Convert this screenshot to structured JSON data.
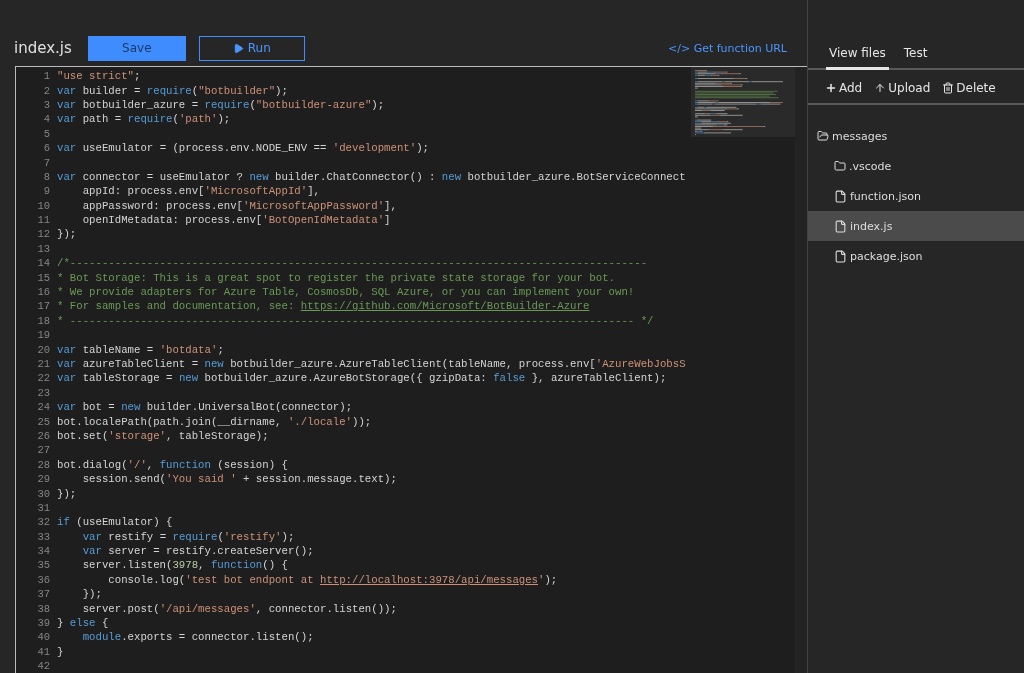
{
  "editor": {
    "filename": "index.js",
    "save_button": "Save",
    "run_button": "Run",
    "function_url_link": "</> Get function URL",
    "lines": [
      {
        "number": "1",
        "tokens": [
          {
            "kind": "string",
            "text": "\"use strict\""
          },
          {
            "kind": "plain",
            "text": ";"
          }
        ]
      },
      {
        "number": "2",
        "tokens": [
          {
            "kind": "keyword",
            "text": "var"
          },
          {
            "kind": "plain",
            "text": " builder = "
          },
          {
            "kind": "keyword",
            "text": "require"
          },
          {
            "kind": "plain",
            "text": "("
          },
          {
            "kind": "string",
            "text": "\"botbuilder\""
          },
          {
            "kind": "plain",
            "text": ");"
          }
        ]
      },
      {
        "number": "3",
        "tokens": [
          {
            "kind": "keyword",
            "text": "var"
          },
          {
            "kind": "plain",
            "text": " botbuilder_azure = "
          },
          {
            "kind": "keyword",
            "text": "require"
          },
          {
            "kind": "plain",
            "text": "("
          },
          {
            "kind": "string",
            "text": "\"botbuilder-azure\""
          },
          {
            "kind": "plain",
            "text": ");"
          }
        ]
      },
      {
        "number": "4",
        "tokens": [
          {
            "kind": "keyword",
            "text": "var"
          },
          {
            "kind": "plain",
            "text": " path = "
          },
          {
            "kind": "keyword",
            "text": "require"
          },
          {
            "kind": "plain",
            "text": "("
          },
          {
            "kind": "string",
            "text": "'path'"
          },
          {
            "kind": "plain",
            "text": ");"
          }
        ]
      },
      {
        "number": "5"
      },
      {
        "number": "6",
        "tokens": [
          {
            "kind": "keyword",
            "text": "var"
          },
          {
            "kind": "plain",
            "text": " useEmulator = (process.env.NODE_ENV == "
          },
          {
            "kind": "string",
            "text": "'development'"
          },
          {
            "kind": "plain",
            "text": ");"
          }
        ]
      },
      {
        "number": "7"
      },
      {
        "number": "8",
        "tokens": [
          {
            "kind": "keyword",
            "text": "var"
          },
          {
            "kind": "plain",
            "text": " connector = useEmulator ? "
          },
          {
            "kind": "keyword",
            "text": "new"
          },
          {
            "kind": "plain",
            "text": " builder.ChatConnector() : "
          },
          {
            "kind": "keyword",
            "text": "new"
          },
          {
            "kind": "plain",
            "text": " botbuilder_azure.BotServiceConnect"
          }
        ]
      },
      {
        "number": "9",
        "tokens": [
          {
            "kind": "plain",
            "text": "    appId: process.env["
          },
          {
            "kind": "string",
            "text": "'MicrosoftAppId'"
          },
          {
            "kind": "plain",
            "text": "],"
          }
        ]
      },
      {
        "number": "10",
        "tokens": [
          {
            "kind": "plain",
            "text": "    appPassword: process.env["
          },
          {
            "kind": "string",
            "text": "'MicrosoftAppPassword'"
          },
          {
            "kind": "plain",
            "text": "],"
          }
        ]
      },
      {
        "number": "11",
        "tokens": [
          {
            "kind": "plain",
            "text": "    openIdMetadata: process.env["
          },
          {
            "kind": "string",
            "text": "'BotOpenIdMetadata'"
          },
          {
            "kind": "plain",
            "text": "]"
          }
        ]
      },
      {
        "number": "12",
        "tokens": [
          {
            "kind": "plain",
            "text": "});"
          }
        ]
      },
      {
        "number": "13"
      },
      {
        "number": "14",
        "tokens": [
          {
            "kind": "comment",
            "text": "/*------------------------------------------------------------------------------------------"
          }
        ]
      },
      {
        "number": "15",
        "tokens": [
          {
            "kind": "comment",
            "text": "* Bot Storage: This is a great spot to register the private state storage for your bot."
          }
        ]
      },
      {
        "number": "16",
        "tokens": [
          {
            "kind": "comment",
            "text": "* We provide adapters for Azure Table, CosmosDb, SQL Azure, or you can implement your own!"
          }
        ]
      },
      {
        "number": "17",
        "tokens": [
          {
            "kind": "comment",
            "text": "* For samples and documentation, see: "
          },
          {
            "kind": "comment_link",
            "text": "https://github.com/Microsoft/BotBuilder-Azure"
          }
        ]
      },
      {
        "number": "18",
        "tokens": [
          {
            "kind": "comment",
            "text": "* ---------------------------------------------------------------------------------------- */"
          }
        ]
      },
      {
        "number": "19"
      },
      {
        "number": "20",
        "tokens": [
          {
            "kind": "keyword",
            "text": "var"
          },
          {
            "kind": "plain",
            "text": " tableName = "
          },
          {
            "kind": "string",
            "text": "'botdata'"
          },
          {
            "kind": "plain",
            "text": ";"
          }
        ]
      },
      {
        "number": "21",
        "tokens": [
          {
            "kind": "keyword",
            "text": "var"
          },
          {
            "kind": "plain",
            "text": " azureTableClient = "
          },
          {
            "kind": "keyword",
            "text": "new"
          },
          {
            "kind": "plain",
            "text": " botbuilder_azure.AzureTableClient(tableName, process.env["
          },
          {
            "kind": "string",
            "text": "'AzureWebJobsS"
          }
        ]
      },
      {
        "number": "22",
        "tokens": [
          {
            "kind": "keyword",
            "text": "var"
          },
          {
            "kind": "plain",
            "text": " tableStorage = "
          },
          {
            "kind": "keyword",
            "text": "new"
          },
          {
            "kind": "plain",
            "text": " botbuilder_azure.AzureBotStorage({ gzipData: "
          },
          {
            "kind": "keyword",
            "text": "false"
          },
          {
            "kind": "plain",
            "text": " }, azureTableClient);"
          }
        ]
      },
      {
        "number": "23"
      },
      {
        "number": "24",
        "tokens": [
          {
            "kind": "keyword",
            "text": "var"
          },
          {
            "kind": "plain",
            "text": " bot = "
          },
          {
            "kind": "keyword",
            "text": "new"
          },
          {
            "kind": "plain",
            "text": " builder.UniversalBot(connector);"
          }
        ]
      },
      {
        "number": "25",
        "tokens": [
          {
            "kind": "plain",
            "text": "bot.localePath(path.join(__dirname, "
          },
          {
            "kind": "string",
            "text": "'./locale'"
          },
          {
            "kind": "plain",
            "text": "));"
          }
        ]
      },
      {
        "number": "26",
        "tokens": [
          {
            "kind": "plain",
            "text": "bot.set("
          },
          {
            "kind": "string",
            "text": "'storage'"
          },
          {
            "kind": "plain",
            "text": ", tableStorage);"
          }
        ]
      },
      {
        "number": "27"
      },
      {
        "number": "28",
        "tokens": [
          {
            "kind": "plain",
            "text": "bot.dialog("
          },
          {
            "kind": "string",
            "text": "'/'"
          },
          {
            "kind": "plain",
            "text": ", "
          },
          {
            "kind": "keyword",
            "text": "function"
          },
          {
            "kind": "plain",
            "text": " (session) {"
          }
        ]
      },
      {
        "number": "29",
        "tokens": [
          {
            "kind": "plain",
            "text": "    session.send("
          },
          {
            "kind": "string",
            "text": "'You said '"
          },
          {
            "kind": "plain",
            "text": " + session.message.text);"
          }
        ]
      },
      {
        "number": "30",
        "tokens": [
          {
            "kind": "plain",
            "text": "});"
          }
        ]
      },
      {
        "number": "31"
      },
      {
        "number": "32",
        "tokens": [
          {
            "kind": "keyword",
            "text": "if"
          },
          {
            "kind": "plain",
            "text": " (useEmulator) {"
          }
        ]
      },
      {
        "number": "33",
        "tokens": [
          {
            "kind": "keyword",
            "text": "    var"
          },
          {
            "kind": "plain",
            "text": " restify = "
          },
          {
            "kind": "keyword",
            "text": "require"
          },
          {
            "kind": "plain",
            "text": "("
          },
          {
            "kind": "string",
            "text": "'restify'"
          },
          {
            "kind": "plain",
            "text": ");"
          }
        ]
      },
      {
        "number": "34",
        "tokens": [
          {
            "kind": "keyword",
            "text": "    var"
          },
          {
            "kind": "plain",
            "text": " server = restify.createServer();"
          }
        ]
      },
      {
        "number": "35",
        "tokens": [
          {
            "kind": "plain",
            "text": "    server.listen("
          },
          {
            "kind": "number",
            "text": "3978"
          },
          {
            "kind": "plain",
            "text": ", "
          },
          {
            "kind": "keyword",
            "text": "function"
          },
          {
            "kind": "plain",
            "text": "() {"
          }
        ]
      },
      {
        "number": "36",
        "tokens": [
          {
            "kind": "plain",
            "text": "        console.log("
          },
          {
            "kind": "string",
            "text": "'test bot endpont at "
          },
          {
            "kind": "string_link",
            "text": "http://localhost:3978/api/messages"
          },
          {
            "kind": "string",
            "text": "'"
          },
          {
            "kind": "plain",
            "text": ");"
          }
        ]
      },
      {
        "number": "37",
        "tokens": [
          {
            "kind": "plain",
            "text": "    });"
          }
        ]
      },
      {
        "number": "38",
        "tokens": [
          {
            "kind": "plain",
            "text": "    server.post("
          },
          {
            "kind": "string",
            "text": "'/api/messages'"
          },
          {
            "kind": "plain",
            "text": ", connector.listen());"
          }
        ]
      },
      {
        "number": "39",
        "tokens": [
          {
            "kind": "plain",
            "text": "} "
          },
          {
            "kind": "keyword",
            "text": "else"
          },
          {
            "kind": "plain",
            "text": " {"
          }
        ]
      },
      {
        "number": "40",
        "tokens": [
          {
            "kind": "keyword",
            "text": "    module"
          },
          {
            "kind": "plain",
            "text": ".exports = connector.listen();"
          }
        ]
      },
      {
        "number": "41",
        "tokens": [
          {
            "kind": "plain",
            "text": "}"
          }
        ]
      },
      {
        "number": "42"
      }
    ]
  },
  "side_panel": {
    "tabs": [
      {
        "label": "View files",
        "selected": true
      },
      {
        "label": "Test",
        "selected": false
      }
    ],
    "toolbar": [
      {
        "kind": "add",
        "label": "Add"
      },
      {
        "kind": "upload",
        "label": "Upload"
      },
      {
        "kind": "delete",
        "label": "Delete"
      }
    ],
    "tree": [
      {
        "kind": "folder",
        "name": "messages",
        "expanded": true,
        "selected": false,
        "children": [
          {
            "kind": "folder",
            "name": ".vscode",
            "expanded": false,
            "selected": false
          },
          {
            "kind": "file",
            "name": "function.json",
            "selected": false
          },
          {
            "kind": "file",
            "name": "index.js",
            "selected": true
          },
          {
            "kind": "file",
            "name": "package.json",
            "selected": false
          }
        ]
      }
    ]
  }
}
